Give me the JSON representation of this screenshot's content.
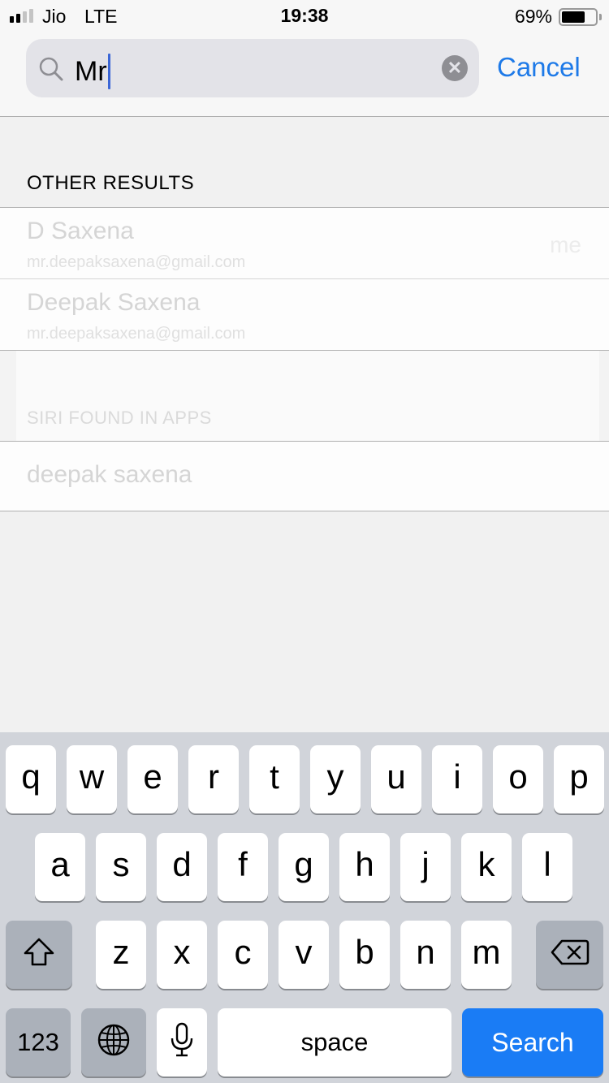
{
  "status_bar": {
    "carrier": "Jio",
    "network": "LTE",
    "time": "19:38",
    "battery_percent_label": "69%",
    "battery_level": 0.69,
    "signal_bars_filled": 2,
    "signal_bars_total": 4
  },
  "search": {
    "query": "Mr",
    "search_icon": "magnifier-icon",
    "clear_icon": "clear-x-icon",
    "clear_glyph": "✕",
    "cancel_label": "Cancel"
  },
  "sections": {
    "other_results_header": "OTHER RESULTS",
    "siri_header": "SIRI FOUND IN APPS"
  },
  "other_results": [
    {
      "name": "D Saxena",
      "email": "mr.deepaksaxena@gmail.com",
      "tag": "me"
    },
    {
      "name": "Deepak Saxena",
      "email": "mr.deepaksaxena@gmail.com",
      "tag": ""
    }
  ],
  "siri_results": [
    {
      "name": "deepak saxena"
    }
  ],
  "keyboard": {
    "row1": [
      "q",
      "w",
      "e",
      "r",
      "t",
      "y",
      "u",
      "i",
      "o",
      "p"
    ],
    "row2": [
      "a",
      "s",
      "d",
      "f",
      "g",
      "h",
      "j",
      "k",
      "l"
    ],
    "row3": [
      "z",
      "x",
      "c",
      "v",
      "b",
      "n",
      "m"
    ],
    "numbers_label": "123",
    "space_label": "space",
    "search_label": "Search",
    "shift_icon": "shift-icon",
    "delete_icon": "backspace-icon",
    "globe_icon": "globe-icon",
    "mic_icon": "microphone-icon"
  },
  "colors": {
    "accent": "#1e7ae8",
    "search_key": "#1a7cf5",
    "keyboard_bg": "#d1d4da",
    "special_key": "#abb1ba",
    "caret": "#3b66d6"
  }
}
